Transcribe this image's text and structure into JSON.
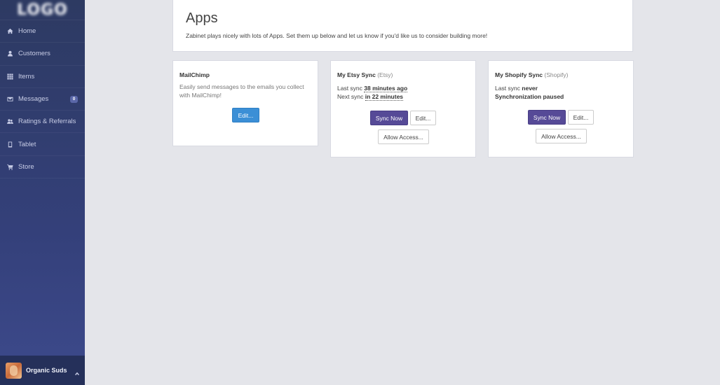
{
  "sidebar": {
    "logo_text": "LOGO",
    "items": [
      {
        "label": "Home",
        "icon": "home-icon"
      },
      {
        "label": "Customers",
        "icon": "user-icon"
      },
      {
        "label": "Items",
        "icon": "grid-icon"
      },
      {
        "label": "Messages",
        "icon": "envelope-icon",
        "badge": "0"
      },
      {
        "label": "Ratings & Referrals",
        "icon": "users-icon"
      },
      {
        "label": "Tablet",
        "icon": "tablet-icon"
      },
      {
        "label": "Store",
        "icon": "cart-icon"
      }
    ],
    "profile": {
      "name": "Organic Suds"
    }
  },
  "header": {
    "title": "Apps",
    "subtitle": "Zabinet plays nicely with lots of Apps. Set them up below and let us know if you'd like us to consider building more!"
  },
  "apps": {
    "mailchimp": {
      "title": "MailChimp",
      "description": "Easily send messages to the emails you collect with MailChimp!",
      "edit_label": "Edit..."
    },
    "etsy": {
      "title": "My Etsy Sync",
      "platform": "(Etsy)",
      "last_sync_label": "Last sync",
      "last_sync_value": "38 minutes ago",
      "next_sync_label": "Next sync",
      "next_sync_value": "in 22 minutes",
      "sync_now_label": "Sync Now",
      "edit_label": "Edit...",
      "allow_access_label": "Allow Access..."
    },
    "shopify": {
      "title": "My Shopify Sync",
      "platform": "(Shopify)",
      "last_sync_label": "Last sync",
      "last_sync_value": "never",
      "status": "Synchronization paused",
      "sync_now_label": "Sync Now",
      "edit_label": "Edit...",
      "allow_access_label": "Allow Access..."
    }
  },
  "colors": {
    "sidebar_bg": "#2d3a62",
    "page_bg": "#e4e5ea",
    "primary_blue": "#3b8fd6",
    "sync_purple": "#564a97"
  }
}
